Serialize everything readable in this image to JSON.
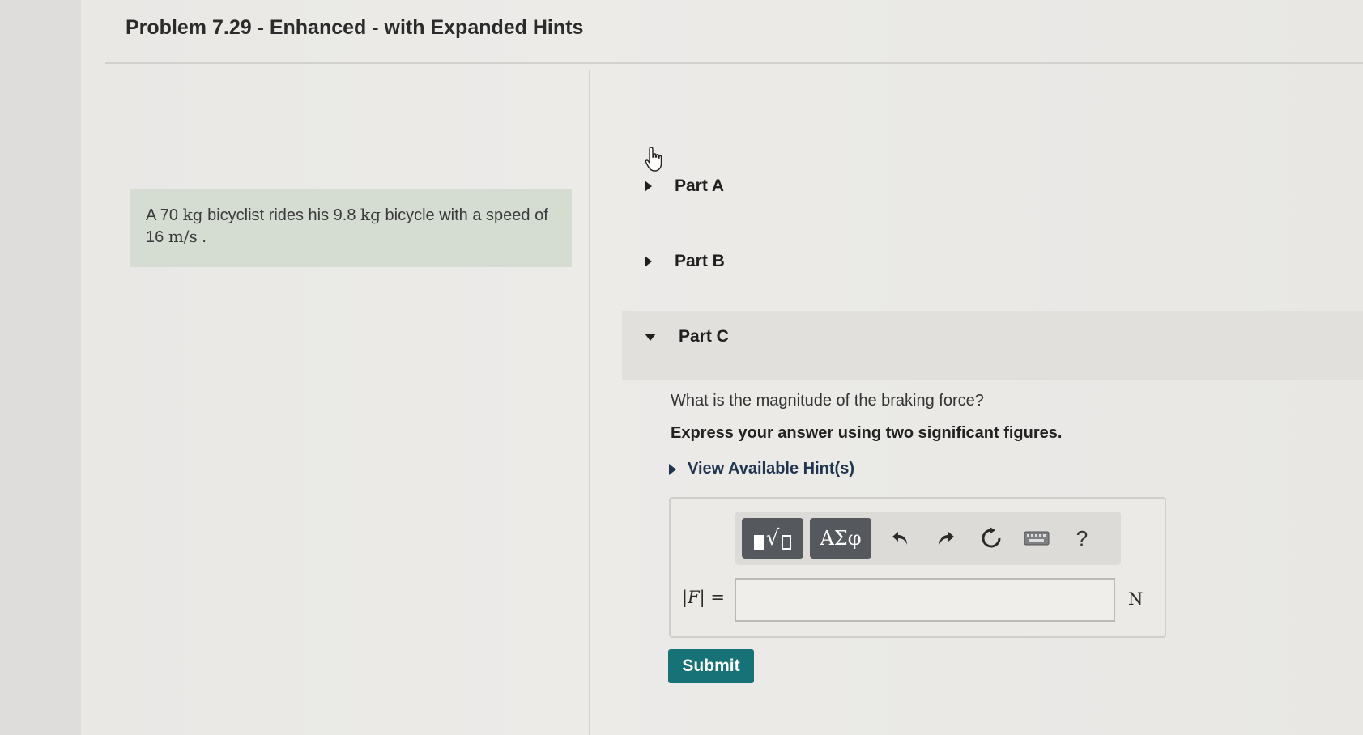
{
  "problem": {
    "title": "Problem 7.29 - Enhanced - with Expanded Hints",
    "statement": {
      "part1": "A 70 ",
      "unit1": "kg",
      "part2": " bicyclist rides his 9.8 ",
      "unit2": "kg",
      "part3": " bicycle with a speed of 16 ",
      "unit3": "m/s",
      "part4": " ."
    }
  },
  "parts": {
    "a": {
      "label": "Part A",
      "expanded": false
    },
    "b": {
      "label": "Part B",
      "expanded": false
    },
    "c": {
      "label": "Part C",
      "expanded": true
    }
  },
  "part_c": {
    "question": "What is the magnitude of the braking force?",
    "instruction": "Express your answer using two significant figures.",
    "hints_label": "View Available Hint(s)",
    "toolbar": {
      "templates_icon": "templates-icon",
      "symbols_label": "ΑΣφ",
      "undo_icon": "undo-icon",
      "redo_icon": "redo-icon",
      "reset_icon": "reset-icon",
      "keyboard_icon": "keyboard-icon",
      "help_label": "?"
    },
    "answer": {
      "label_open": "|",
      "label_var": "F",
      "label_close": "| =",
      "value": "",
      "unit": "N"
    },
    "submit_label": "Submit"
  },
  "colors": {
    "submit_bg": "#167276",
    "problem_box_bg": "#d5ddd3",
    "toolbar_button_bg": "#55585c"
  }
}
